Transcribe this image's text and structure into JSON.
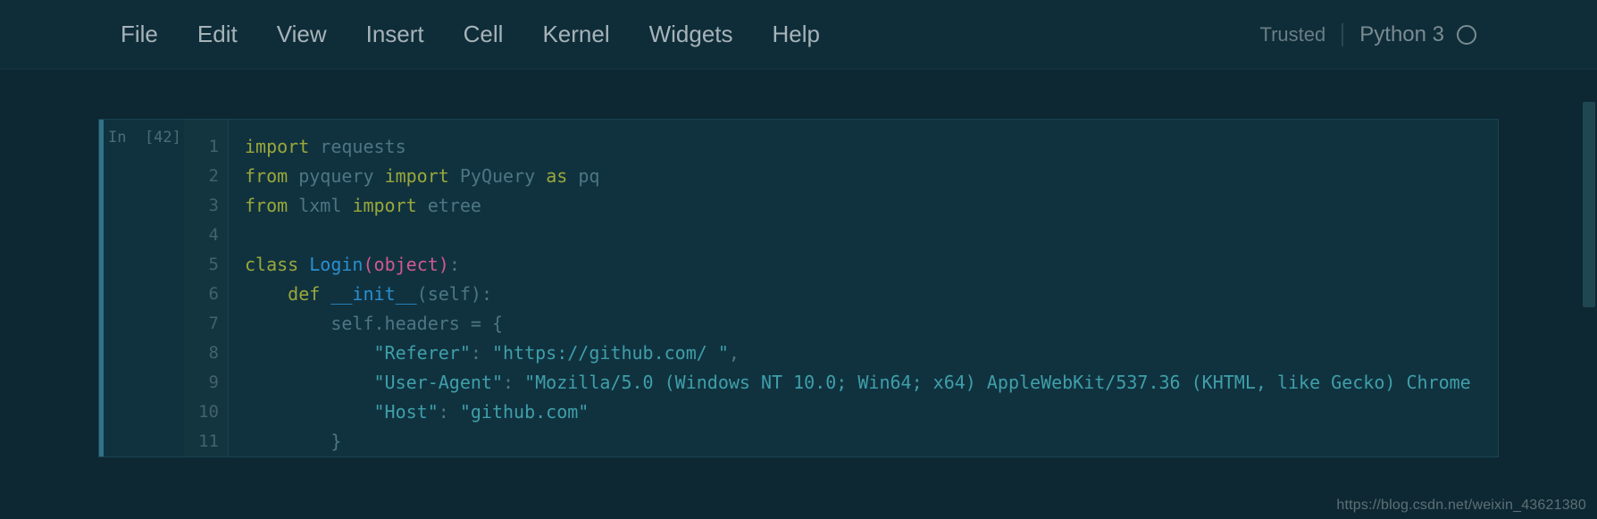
{
  "menu": {
    "items": [
      "File",
      "Edit",
      "View",
      "Insert",
      "Cell",
      "Kernel",
      "Widgets",
      "Help"
    ]
  },
  "status": {
    "trusted": "Trusted",
    "kernel": "Python 3"
  },
  "cell": {
    "prompt": "In  [42]:",
    "line_numbers": [
      "1",
      "2",
      "3",
      "4",
      "5",
      "6",
      "7",
      "8",
      "9",
      "10",
      "11"
    ],
    "code": {
      "l1": {
        "kw1": "import",
        "mod": "requests"
      },
      "l2": {
        "kw1": "from",
        "mod": "pyquery",
        "kw2": "import",
        "cls": "PyQuery",
        "kw3": "as",
        "alias": "pq"
      },
      "l3": {
        "kw1": "from",
        "mod": "lxml",
        "kw2": "import",
        "sub": "etree"
      },
      "l5": {
        "kw": "class",
        "name": "Login",
        "lp": "(",
        "obj": "object",
        "rp": ")",
        "colon": ":"
      },
      "l6": {
        "kw": "def",
        "fn": "__init__",
        "lp": "(",
        "arg": "self",
        "rp": ")",
        "colon": ":"
      },
      "l7": {
        "lhs": "self.headers ",
        "op": "=",
        "brace": " {"
      },
      "l8": {
        "k": "\"Referer\"",
        "colon": ": ",
        "v": "\"https://github.com/ \"",
        "comma": ","
      },
      "l9": {
        "k": "\"User-Agent\"",
        "colon": ": ",
        "v": "\"Mozilla/5.0 (Windows NT 10.0; Win64; x64) AppleWebKit/537.36 (KHTML, like Gecko) Chrome",
        "tail": ""
      },
      "l10": {
        "k": "\"Host\"",
        "colon": ": ",
        "v": "\"github.com\""
      },
      "l11": {
        "brace": "}"
      }
    }
  },
  "watermark": "https://blog.csdn.net/weixin_43621380"
}
